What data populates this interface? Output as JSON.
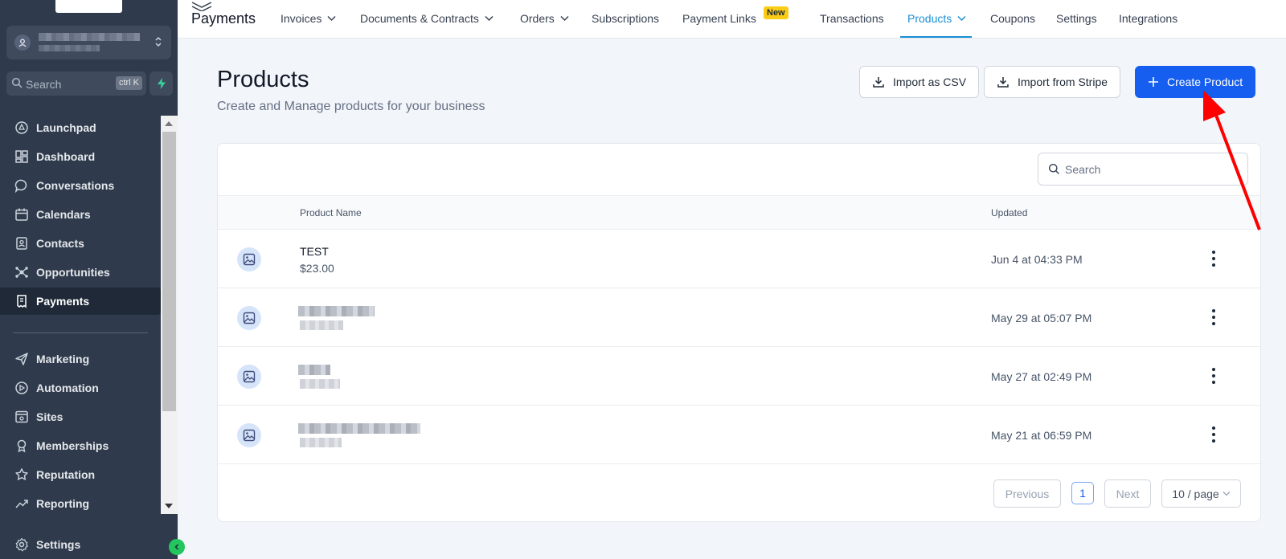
{
  "sidebar": {
    "search_label": "Search",
    "search_shortcut": "ctrl K",
    "items": [
      {
        "label": "Launchpad",
        "icon": "rocket-icon"
      },
      {
        "label": "Dashboard",
        "icon": "dashboard-icon"
      },
      {
        "label": "Conversations",
        "icon": "chat-icon"
      },
      {
        "label": "Calendars",
        "icon": "calendar-icon"
      },
      {
        "label": "Contacts",
        "icon": "contacts-icon"
      },
      {
        "label": "Opportunities",
        "icon": "opportunities-icon"
      },
      {
        "label": "Payments",
        "icon": "payments-icon",
        "active": true
      },
      {
        "label": "Marketing",
        "icon": "send-icon"
      },
      {
        "label": "Automation",
        "icon": "automation-icon"
      },
      {
        "label": "Sites",
        "icon": "sites-icon"
      },
      {
        "label": "Memberships",
        "icon": "memberships-icon"
      },
      {
        "label": "Reputation",
        "icon": "star-icon"
      },
      {
        "label": "Reporting",
        "icon": "reporting-icon"
      }
    ],
    "settings_label": "Settings"
  },
  "topnav": {
    "brand": "Payments",
    "items": [
      {
        "label": "Invoices",
        "dropdown": true
      },
      {
        "label": "Documents & Contracts",
        "dropdown": true
      },
      {
        "label": "Orders",
        "dropdown": true
      },
      {
        "label": "Subscriptions"
      },
      {
        "label": "Payment Links",
        "badge": "New"
      },
      {
        "label": "Transactions"
      },
      {
        "label": "Products",
        "dropdown": true,
        "active": true
      },
      {
        "label": "Coupons"
      },
      {
        "label": "Settings"
      },
      {
        "label": "Integrations"
      }
    ],
    "accent": "#1b8ed6"
  },
  "header": {
    "title": "Products",
    "subtitle": "Create and Manage products for your business",
    "import_csv": "Import as CSV",
    "import_stripe": "Import from Stripe",
    "create": "Create Product"
  },
  "table": {
    "search_placeholder": "Search",
    "columns": [
      "Product Name",
      "Updated"
    ],
    "rows": [
      {
        "name": "TEST",
        "price": "$23.00",
        "updated": "Jun 4 at 04:33 PM",
        "redacted": false
      },
      {
        "name": "",
        "price": "",
        "updated": "May 29 at 05:07 PM",
        "redacted": true
      },
      {
        "name": "",
        "price": "",
        "updated": "May 27 at 02:49 PM",
        "redacted": true
      },
      {
        "name": "",
        "price": "",
        "updated": "May 21 at 06:59 PM",
        "redacted": true
      }
    ]
  },
  "pagination": {
    "previous": "Previous",
    "page": "1",
    "next": "Next",
    "page_size": "10 / page"
  },
  "colors": {
    "primary": "#155eef",
    "sidebar_bg": "#2f3b4c",
    "annotation_arrow": "#ff0000"
  }
}
